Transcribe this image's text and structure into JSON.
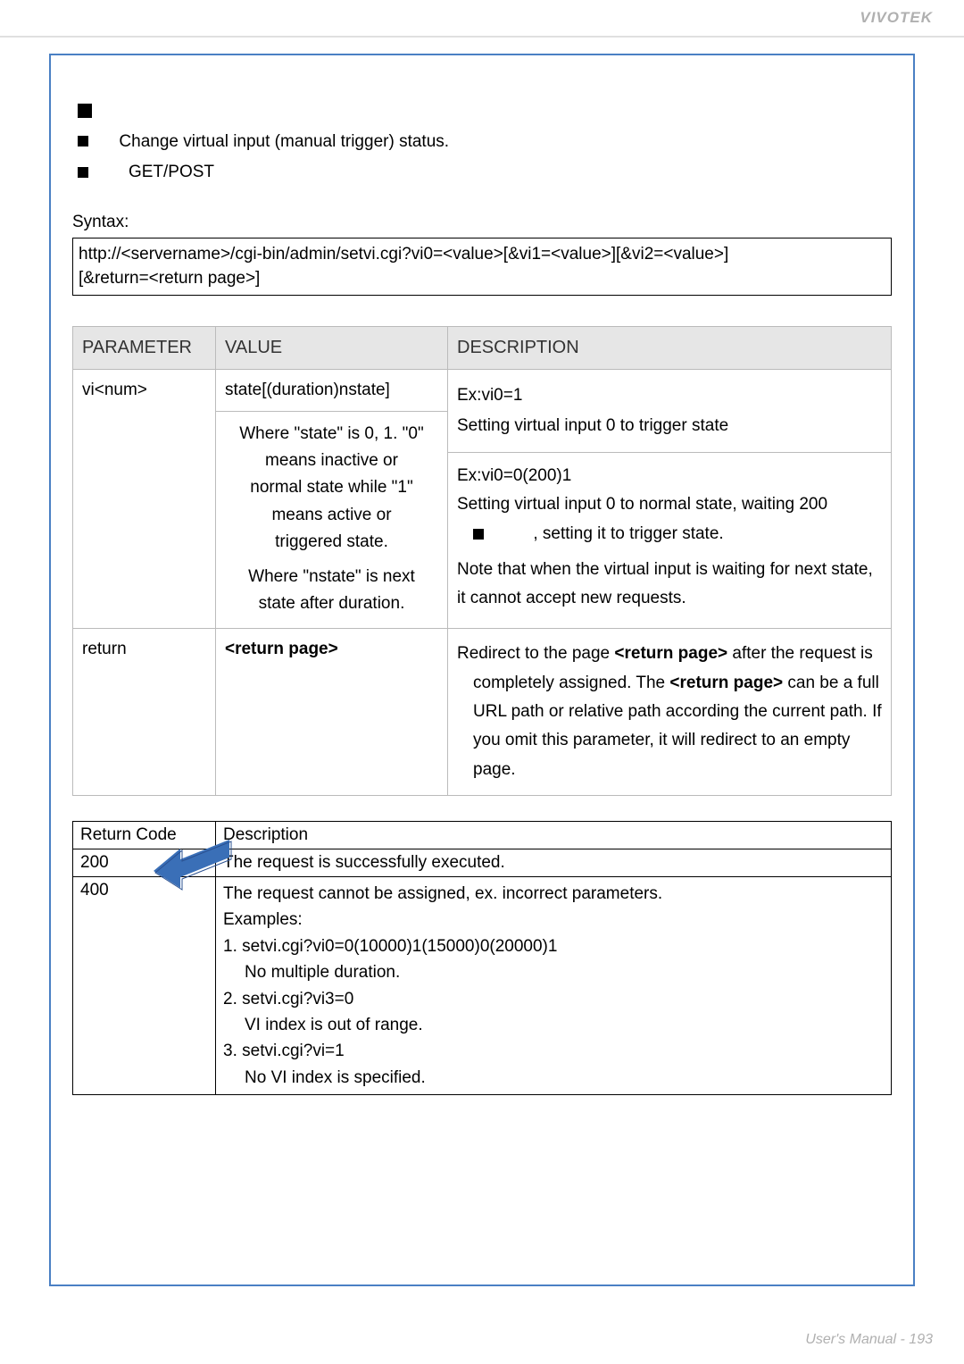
{
  "header": {
    "brand": "VIVOTEK"
  },
  "intro": {
    "line1": "Change virtual input (manual trigger) status.",
    "line2": "GET/POST"
  },
  "syntax": {
    "label": "Syntax:",
    "line1": "http://<servername>/cgi-bin/admin/setvi.cgi?vi0=<value>[&vi1=<value>][&vi2=<value>]",
    "line2": "[&return=<return page>]"
  },
  "ptable": {
    "head": {
      "c1": "PARAMETER",
      "c2": "VALUE",
      "c3": "DESCRIPTION"
    },
    "rows": [
      {
        "param": "vi<num>",
        "value_top": "state[(duration)nstate]",
        "value_sub": "Where \"state\" is 0, 1. \"0\" means inactive or normal state while \"1\" means active or triggered state.\nWhere \"nstate\" is next state after duration.",
        "desc_top_l1": "Ex:vi0=1",
        "desc_top_l2": "Setting virtual input 0 to trigger state",
        "desc_sub_l1": "Ex:vi0=0(200)1",
        "desc_sub_l2a": "Setting virtual input 0 to normal state, waiting 200",
        "desc_sub_l2b": ", setting it to trigger state.",
        "desc_sub_l3": "Note that when the virtual input is waiting for next state, it cannot accept new requests."
      },
      {
        "param": "return",
        "value_top": "<return page>",
        "desc": "Redirect to the page <return page> after the request is completely assigned. The <return page> can be a full URL path or relative path according the current path. If you omit this parameter, it will redirect to an empty page."
      }
    ]
  },
  "rtable": {
    "head": {
      "c1": "Return Code",
      "c2": "Description"
    },
    "rows": [
      {
        "code": "200",
        "desc": "The request is successfully executed."
      },
      {
        "code": "400",
        "lines": [
          "The request cannot be assigned, ex. incorrect parameters.",
          "Examples:",
          "1. setvi.cgi?vi0=0(10000)1(15000)0(20000)1",
          "    No multiple duration.",
          "2. setvi.cgi?vi3=0",
          "    VI index is out of range.",
          "3. setvi.cgi?vi=1",
          "    No VI index is specified."
        ]
      }
    ]
  },
  "footer": {
    "text": "User's Manual - 193"
  }
}
